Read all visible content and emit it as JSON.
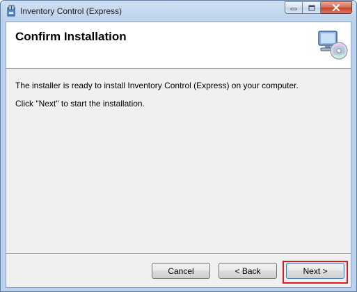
{
  "window": {
    "title": "Inventory Control (Express)",
    "icon": "installer-package-icon",
    "caption_buttons": [
      "minimize",
      "maximize",
      "close"
    ]
  },
  "banner": {
    "title": "Confirm Installation",
    "icon": "computer-with-cd-icon"
  },
  "content": {
    "message": "The installer is ready to install Inventory Control (Express) on your computer.",
    "instruction": "Click \"Next\" to start the installation."
  },
  "buttons": {
    "cancel": "Cancel",
    "back": "< Back",
    "next": "Next >"
  },
  "colors": {
    "highlight": "#e0191f",
    "titlebar": "#bcd2ec",
    "dialog_bg": "#f0f0f0"
  }
}
